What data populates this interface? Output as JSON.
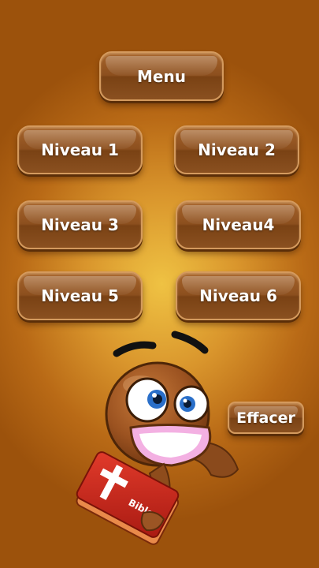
{
  "menu": {
    "label": "Menu"
  },
  "levels": [
    {
      "label": "Niveau 1"
    },
    {
      "label": "Niveau 2"
    },
    {
      "label": "Niveau 3"
    },
    {
      "label": "Niveau4"
    },
    {
      "label": "Niveau 5"
    },
    {
      "label": "Niveau 6"
    }
  ],
  "clear": {
    "label": "Effacer"
  },
  "mascot": {
    "book_text": "Bible",
    "icon": "grinning-mascot-with-bible"
  },
  "colors": {
    "button_fill": "#8c4f1e",
    "button_border": "#d49a5e",
    "background_center": "#efc243",
    "background_edge": "#9c520c"
  }
}
